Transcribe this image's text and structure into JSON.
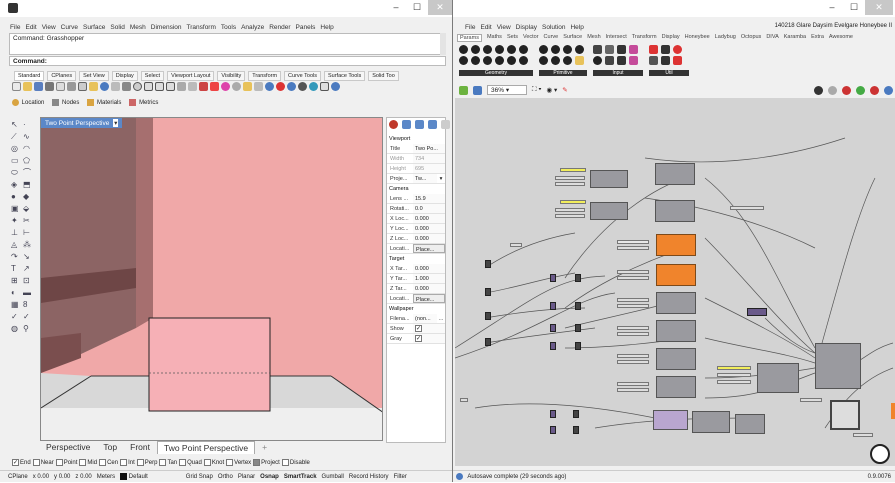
{
  "rhino": {
    "menu": [
      "File",
      "Edit",
      "View",
      "Curve",
      "Surface",
      "Solid",
      "Mesh",
      "Dimension",
      "Transform",
      "Tools",
      "Analyze",
      "Render",
      "Panels",
      "Help"
    ],
    "command_history": "Command: Grasshopper",
    "command_label": "Command:",
    "toolbar_tabs": [
      "Standard",
      "CPlanes",
      "Set View",
      "Display",
      "Select",
      "Viewport Layout",
      "Visibility",
      "Transform",
      "Curve Tools",
      "Surface Tools",
      "Solid Too"
    ],
    "panel_tabs": [
      "Location",
      "Nodes",
      "Materials",
      "Metrics"
    ],
    "viewport_title": "Two Point Perspective",
    "properties": {
      "viewport_section": "Viewport",
      "title_label": "Title",
      "title_value": "Two Po...",
      "width_label": "Width",
      "width_value": "734",
      "height_label": "Height",
      "height_value": "695",
      "projection_label": "Proje...",
      "projection_value": "Tw...",
      "camera_section": "Camera",
      "lens_label": "Lens ...",
      "lens_value": "15.9",
      "rotation_label": "Rotati...",
      "rotation_value": "0.0",
      "xloc_label": "X Loc...",
      "xloc_value": "0.000",
      "yloc_label": "Y Loc...",
      "yloc_value": "0.000",
      "zloc_label": "Z Loc...",
      "zloc_value": "0.000",
      "location_label": "Locati...",
      "location_button": "Place...",
      "target_section": "Target",
      "xtar_label": "X Tar...",
      "xtar_value": "0.000",
      "ytar_label": "Y Tar...",
      "ytar_value": "1.000",
      "ztar_label": "Z Tar...",
      "ztar_value": "0.000",
      "tlocation_label": "Locati...",
      "tlocation_button": "Place...",
      "wallpaper_section": "Wallpaper",
      "filename_label": "Filena...",
      "filename_value": "(non...",
      "show_label": "Show",
      "gray_label": "Gray"
    },
    "viewport_tabs": [
      "Perspective",
      "Top",
      "Front",
      "Two Point Perspective",
      "+"
    ],
    "osnaps": [
      "End",
      "Near",
      "Point",
      "Mid",
      "Cen",
      "Int",
      "Perp",
      "Tan",
      "Quad",
      "Knot",
      "Vertex",
      "Project",
      "Disable"
    ],
    "status": {
      "cplane": "CPlane",
      "x": "x 0.00",
      "y": "y 0.00",
      "z": "z 0.00",
      "units": "Meters",
      "layer": "Default",
      "items": [
        "Grid Snap",
        "Ortho",
        "Planar",
        "Osnap",
        "SmartTrack",
        "Gumball",
        "Record History",
        "Filter"
      ]
    }
  },
  "grasshopper": {
    "menu": [
      "File",
      "Edit",
      "View",
      "Display",
      "Solution",
      "Help"
    ],
    "doc_title": "140218 Glare Daysim Evelgare Honeybee II",
    "ribbon_tabs": [
      "Params",
      "Maths",
      "Sets",
      "Vector",
      "Curve",
      "Surface",
      "Mesh",
      "Intersect",
      "Transform",
      "Display",
      "Honeybee",
      "Ladybug",
      "Octopus",
      "DIVA",
      "Karamba",
      "Extra",
      "Awesome"
    ],
    "ribbon_groups": [
      "Geometry",
      "Primitive",
      "Input",
      "Util"
    ],
    "zoom": "36%",
    "status": "Autosave complete (29 seconds ago)",
    "version": "0.9.0076"
  },
  "colors": {
    "viewport_pink": "#f0a8a8",
    "gh_canvas": "#d3d3d3",
    "orange_node": "#f0842c"
  }
}
